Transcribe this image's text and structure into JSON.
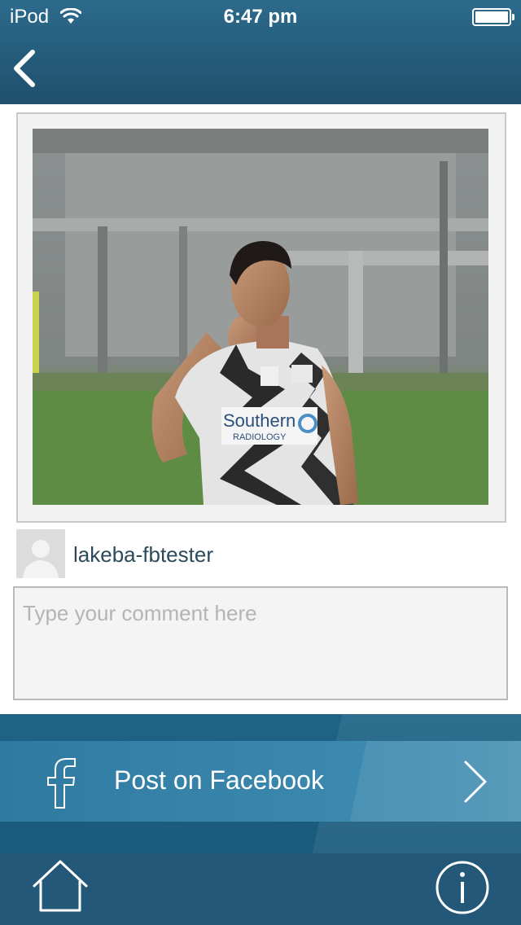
{
  "status_bar": {
    "carrier": "iPod",
    "time": "6:47 pm"
  },
  "nav": {
    "back_icon": "chevron-left-icon"
  },
  "post": {
    "photo_alt": "Rugby player in black and white Southern Radiology jersey clenching fist"
  },
  "user": {
    "name": "lakeba-fbtester",
    "avatar_icon": "default-user-avatar"
  },
  "comment": {
    "placeholder": "Type your comment here",
    "value": ""
  },
  "facebook_button": {
    "label": "Post on Facebook",
    "icon": "facebook-icon",
    "chevron": "chevron-right-icon"
  },
  "tab_bar": {
    "home_icon": "home-icon",
    "info_icon": "info-icon"
  },
  "colors": {
    "header": "#245e80",
    "button": "#3a87ad",
    "bottom_bar": "#235878"
  }
}
